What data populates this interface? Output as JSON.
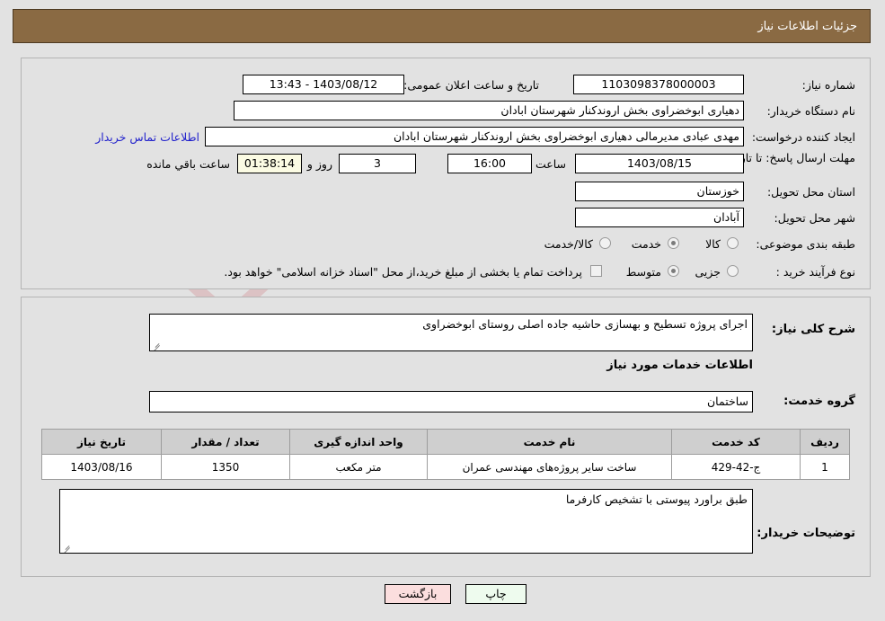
{
  "header": {
    "title": "جزئیات اطلاعات نیاز"
  },
  "watermark": {
    "text": "AriaTender.net"
  },
  "top_panel": {
    "need_number": {
      "label": "شماره نیاز:",
      "value": "1103098378000003"
    },
    "public_announce": {
      "label": "تاریخ و ساعت اعلان عمومی:",
      "value": "1403/08/12 - 13:43"
    },
    "buyer_org": {
      "label": "نام دستگاه خریدار:",
      "value": "دهیاری ابوخضراوی بخش اروندکنار شهرستان ابادان"
    },
    "request_creator": {
      "label": "ایجاد کننده درخواست:",
      "value": "مهدی عبادی مدیرمالی دهیاری ابوخضراوی بخش اروندکنار شهرستان ابادان"
    },
    "buyer_contact_link": "اطلاعات تماس خریدار",
    "deadline": {
      "label": "مهلت ارسال پاسخ: تا تاریخ:",
      "date": "1403/08/15",
      "hour_label": "ساعت",
      "hour": "16:00",
      "days": "3",
      "days_suffix_label": "روز و",
      "timer": "01:38:14",
      "timer_suffix_label": "ساعت باقي مانده"
    },
    "province": {
      "label": "استان محل تحویل:",
      "value": "خوزستان"
    },
    "city": {
      "label": "شهر محل تحویل:",
      "value": "آبادان"
    },
    "subject_class": {
      "label": "طبقه بندی موضوعی:",
      "options": [
        "کالا",
        "خدمت",
        "کالا/خدمت"
      ],
      "selected": "خدمت"
    },
    "purchase_process": {
      "label": "نوع فرآیند خرید :",
      "options": [
        "جزیی",
        "متوسط"
      ],
      "selected": "متوسط",
      "checkbox_label": "پرداخت تمام یا بخشی از مبلغ خرید،از محل \"اسناد خزانه اسلامی\" خواهد بود.",
      "checkbox_checked": false
    }
  },
  "bottom_panel": {
    "general_desc": {
      "label": "شرح کلی نیاز:",
      "value": "اجرای پروژه تسطیح و بهسازی حاشیه جاده اصلی روستای ابوخضراوی"
    },
    "services_section_title": "اطلاعات خدمات مورد نیاز",
    "service_group": {
      "label": "گروه خدمت:",
      "value": "ساختمان"
    },
    "table": {
      "columns": [
        "ردیف",
        "کد خدمت",
        "نام خدمت",
        "واحد اندازه گیری",
        "تعداد / مقدار",
        "تاریخ نیاز"
      ],
      "rows": [
        {
          "row": "1",
          "service_code": "ج-42-429",
          "service_name": "ساخت سایر پروژه‌های مهندسی عمران",
          "unit": "متر مکعب",
          "quantity": "1350",
          "need_date": "1403/08/16"
        }
      ]
    },
    "buyer_remarks": {
      "label": "توضیحات خریدار:",
      "value": "طبق براورد پیوستی با تشخیص کارفرما"
    }
  },
  "footer": {
    "print_label": "چاپ",
    "back_label": "بازگشت"
  },
  "colors": {
    "title_bar": "#8a6a43",
    "page_bg": "#e2e2e2",
    "link": "#2222cc",
    "timer_bg": "#fbfbe3",
    "print_btn_bg": "#eefbee",
    "back_btn_bg": "#fbdede"
  }
}
